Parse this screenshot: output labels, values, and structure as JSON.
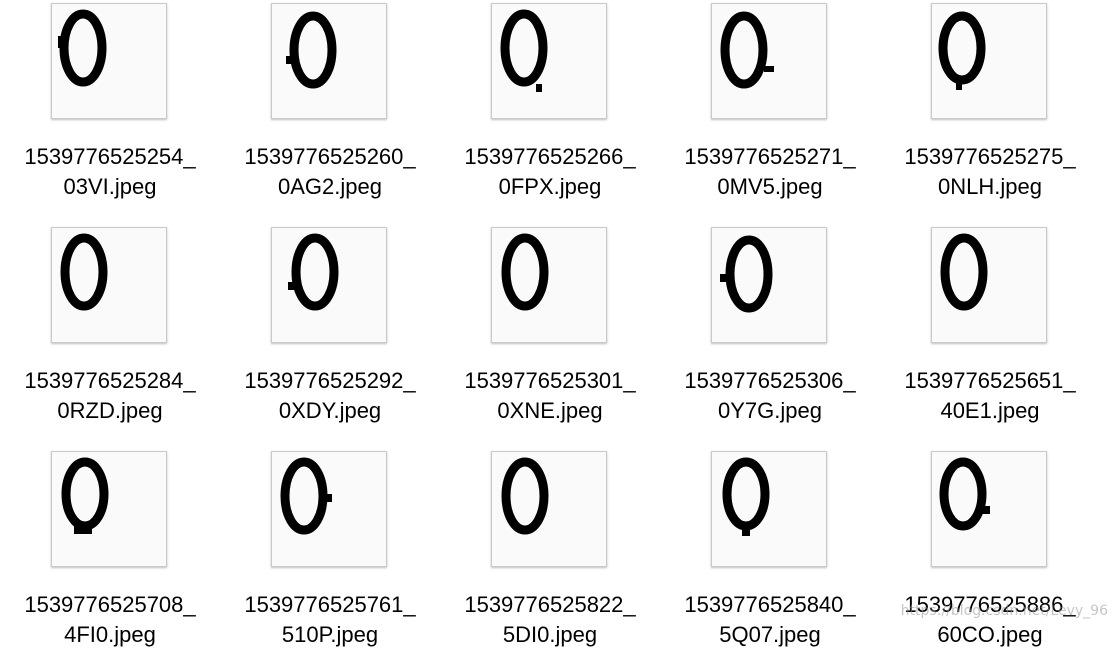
{
  "files": [
    {
      "line1": "1539776525254_",
      "line2": "03VI.jpeg"
    },
    {
      "line1": "1539776525260_",
      "line2": "0AG2.jpeg"
    },
    {
      "line1": "1539776525266_",
      "line2": "0FPX.jpeg"
    },
    {
      "line1": "1539776525271_",
      "line2": "0MV5.jpeg"
    },
    {
      "line1": "1539776525275_",
      "line2": "0NLH.jpeg"
    },
    {
      "line1": "1539776525284_",
      "line2": "0RZD.jpeg"
    },
    {
      "line1": "1539776525292_",
      "line2": "0XDY.jpeg"
    },
    {
      "line1": "1539776525301_",
      "line2": "0XNE.jpeg"
    },
    {
      "line1": "1539776525306_",
      "line2": "0Y7G.jpeg"
    },
    {
      "line1": "1539776525651_",
      "line2": "40E1.jpeg"
    },
    {
      "line1": "1539776525708_",
      "line2": "4FI0.jpeg"
    },
    {
      "line1": "1539776525761_",
      "line2": "510P.jpeg"
    },
    {
      "line1": "1539776525822_",
      "line2": "5DI0.jpeg"
    },
    {
      "line1": "1539776525840_",
      "line2": "5Q07.jpeg"
    },
    {
      "line1": "1539776525886_",
      "line2": "60CO.jpeg"
    }
  ],
  "thumbnail_glyph": "0",
  "watermark": "https://blog.csdn.net/Levy_96"
}
